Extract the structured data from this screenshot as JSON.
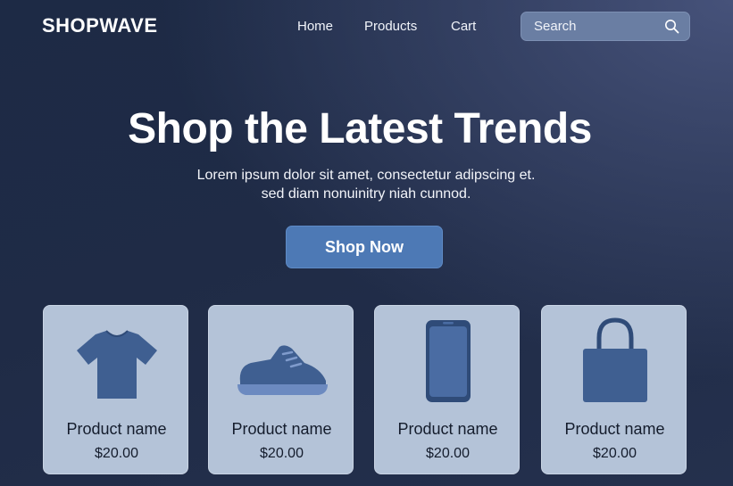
{
  "brand": "SHOPWAVE",
  "nav": {
    "links": [
      "Home",
      "Products",
      "Cart"
    ]
  },
  "search": {
    "placeholder": "Search",
    "icon": "search-icon"
  },
  "hero": {
    "title": "Shop the Latest Trends",
    "subtitle_line1": "Lorem ipsum dolor sit amet, consectetur adipscing et.",
    "subtitle_line2": "sed diam nonuinitry niah cunnod.",
    "cta_label": "Shop Now"
  },
  "products": [
    {
      "name": "Product name",
      "price": "$20.00",
      "icon": "tshirt-icon"
    },
    {
      "name": "Product name",
      "price": "$20.00",
      "icon": "sneaker-icon"
    },
    {
      "name": "Product name",
      "price": "$20.00",
      "icon": "smartphone-icon"
    },
    {
      "name": "Product name",
      "price": "$20.00",
      "icon": "tote-bag-icon"
    }
  ],
  "colors": {
    "accent": "#4d79b5",
    "card_bg": "#b4c3d8",
    "icon_fill": "#3f5f91"
  }
}
